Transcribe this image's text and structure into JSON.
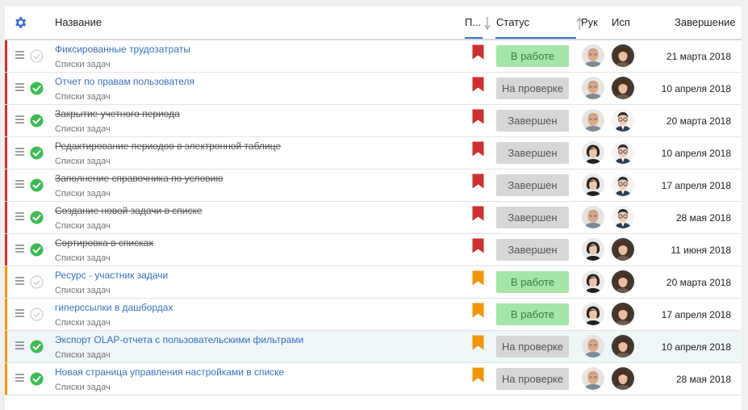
{
  "header": {
    "name": "Название",
    "priority": "П...",
    "status": "Статус",
    "ruk": "Рук",
    "isp": "Исп",
    "end": "Завершение"
  },
  "colors": {
    "accent": "#3a6fd8",
    "red": "#cc3030",
    "orange": "#f0960a",
    "done_green": "#3cba54",
    "link": "#3a6fc0"
  },
  "rows": [
    {
      "title": "Фиксированные трудозатраты",
      "sub": "Списки задач",
      "done": false,
      "priority": "red",
      "status": "В работе",
      "status_kind": "work",
      "ruk": "man-bald",
      "isp": "woman-curly",
      "date": "21 марта 2018"
    },
    {
      "title": "Отчет по правам пользователя",
      "sub": "Списки задач",
      "done": true,
      "priority": "red",
      "status": "На проверке",
      "status_kind": "review",
      "ruk": "man-bald",
      "isp": "woman-curly",
      "date": "10 апреля 2018"
    },
    {
      "title": "Закрытие учетного периода",
      "sub": "Списки задач",
      "done": true,
      "priority": "red",
      "status": "Завершен",
      "status_kind": "done",
      "ruk": "man-bald",
      "isp": "man-glasses",
      "date": "20 марта 2018"
    },
    {
      "title": "Редактирование периодов в электронной таблице",
      "sub": "Списки задач",
      "done": true,
      "priority": "red",
      "status": "Завершен",
      "status_kind": "done",
      "ruk": "woman-short",
      "isp": "man-glasses",
      "date": "10 апреля 2018"
    },
    {
      "title": "Заполнение справочника по условию",
      "sub": "Списки задач",
      "done": true,
      "priority": "red",
      "status": "Завершен",
      "status_kind": "done",
      "ruk": "woman-short",
      "isp": "man-glasses",
      "date": "17 апреля 2018"
    },
    {
      "title": "Создание новой задачи в списке",
      "sub": "Списки задач",
      "done": true,
      "priority": "red",
      "status": "Завершен",
      "status_kind": "done",
      "ruk": "man-bald",
      "isp": "man-glasses",
      "date": "28 мая 2018"
    },
    {
      "title": "Сортировка в списках",
      "sub": "Списки задач",
      "done": true,
      "priority": "red",
      "status": "Завершен",
      "status_kind": "done",
      "ruk": "woman-short",
      "isp": "woman-curly",
      "date": "11 июня 2018"
    },
    {
      "title": "Ресурс - участник задачи",
      "sub": "Списки задач",
      "done": false,
      "priority": "orange",
      "status": "В работе",
      "status_kind": "work",
      "ruk": "woman-short",
      "isp": "woman-curly",
      "date": "20 марта 2018"
    },
    {
      "title": "гиперссылки в дашбордах",
      "sub": "Списки задач",
      "done": false,
      "priority": "orange",
      "status": "В работе",
      "status_kind": "work",
      "ruk": "woman-short",
      "isp": "woman-curly",
      "date": "17 апреля 2018"
    },
    {
      "title": "Экспорт OLAP-отчета с пользовательскими фильтрами",
      "sub": "Списки задач",
      "done": true,
      "priority": "orange",
      "status": "На проверке",
      "status_kind": "review",
      "ruk": "man-bald",
      "isp": "woman-curly",
      "date": "10 апреля 2018",
      "highlight": true
    },
    {
      "title": "Новая страница управления настройками в списке",
      "sub": "Списки задач",
      "done": true,
      "priority": "orange",
      "status": "На проверке",
      "status_kind": "review",
      "ruk": "man-bald",
      "isp": "woman-curly",
      "date": "28 мая 2018"
    }
  ]
}
